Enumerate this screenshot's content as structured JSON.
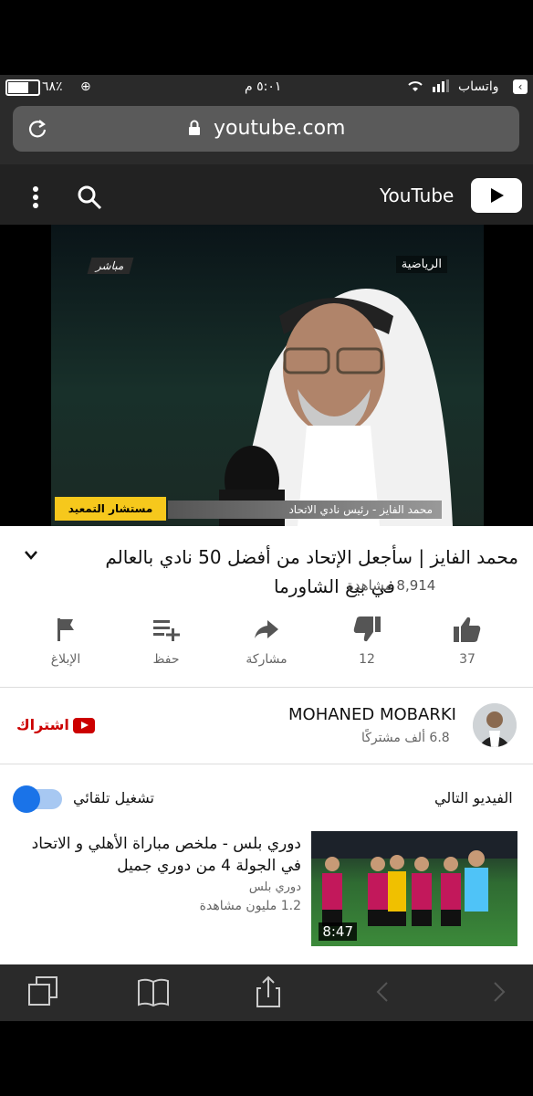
{
  "statusbar": {
    "carrier": "واتساب",
    "time": "٥:٠١ م",
    "battery": "٦٨٪"
  },
  "browser": {
    "url": "youtube.com"
  },
  "header": {
    "brand": "YouTube"
  },
  "video_overlay": {
    "live": "مباشر",
    "channel": "الرياضية",
    "lower_third_left": "مستشار التمعيد",
    "lower_third_right": "محمد الفايز - رئيس نادي الاتحاد",
    "mic_label": "الرياضية"
  },
  "video": {
    "title_line1": "محمد الفايز | سأجعل الإتحاد من أفضل 50 نادي بالعالم",
    "title_line2": "في بيع الشاورما",
    "views": "8,914 مشاهدة"
  },
  "actions": [
    {
      "label": "37",
      "icon": "thumbs-up-icon"
    },
    {
      "label": "12",
      "icon": "thumbs-down-icon"
    },
    {
      "label": "مشاركة",
      "icon": "share-icon"
    },
    {
      "label": "حفظ",
      "icon": "playlist-add-icon"
    },
    {
      "label": "الإبلاغ",
      "icon": "flag-icon"
    }
  ],
  "channel": {
    "name": "MOHANED MOBARKI",
    "subs": "6.8 ألف مشتركًا",
    "subscribe": "اشتراك"
  },
  "upnext": {
    "label": "الفيديو التالي",
    "autoplay": "تشغيل تلقائي",
    "autoplay_on": true
  },
  "related": [
    {
      "title": "دوري بلس - ملخص مباراة الأهلي و الاتحاد في الجولة 4 من دوري جميل",
      "channel": "دوري بلس",
      "views": "1.2 مليون مشاهدة",
      "duration": "8:47"
    }
  ],
  "colors": {
    "accent_red": "#cc0000",
    "toggle_blue": "#1a73e8",
    "toolbar": "#2a2a2a"
  }
}
